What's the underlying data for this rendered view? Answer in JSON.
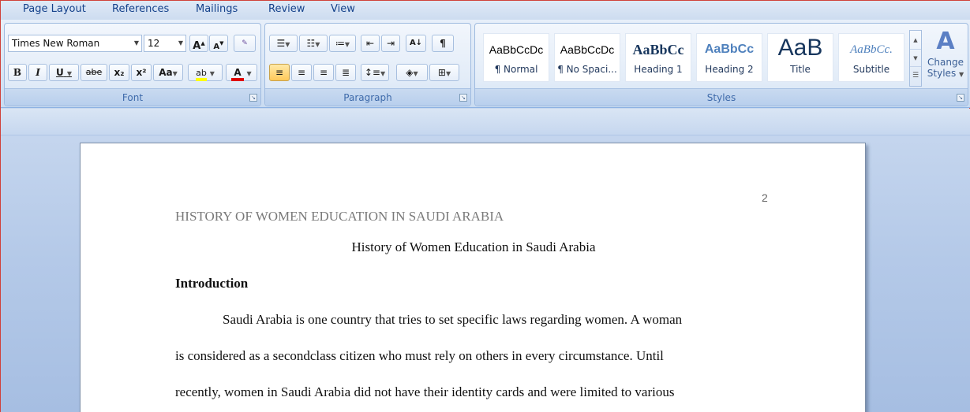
{
  "tabs": [
    "Page Layout",
    "References",
    "Mailings",
    "Review",
    "View"
  ],
  "font": {
    "family": "Times New Roman",
    "size": "12",
    "label": "Font",
    "grow": "A",
    "shrink": "A",
    "bold": "B",
    "italic": "I",
    "underline": "U",
    "strike": "abe",
    "subscript": "x₂",
    "superscript": "x²",
    "change_case": "Aa",
    "highlight": "ab",
    "color": "A"
  },
  "paragraph": {
    "label": "Paragraph",
    "pilcrow": "¶"
  },
  "styles": {
    "label": "Styles",
    "items": [
      {
        "sample": "AaBbCcDc",
        "name": "¶ Normal"
      },
      {
        "sample": "AaBbCcDc",
        "name": "¶ No Spaci..."
      },
      {
        "sample": "AaBbCc",
        "name": "Heading 1"
      },
      {
        "sample": "AaBbCc",
        "name": "Heading 2"
      },
      {
        "sample": "AaB",
        "name": "Title"
      },
      {
        "sample": "AaBbCc.",
        "name": "Subtitle"
      }
    ],
    "change_label_1": "Change",
    "change_label_2": "Styles"
  },
  "colors": {
    "accent": "#15428b",
    "highlight": "#ffff00",
    "font_color": "#e00000"
  },
  "document": {
    "page_number": "2",
    "running_head": "HISTORY OF WOMEN EDUCATION IN SAUDI ARABIA",
    "title": "History of Women Education in Saudi Arabia",
    "heading": "Introduction",
    "lines": [
      "Saudi Arabia is one country that tries to set specific laws regarding women. A woman",
      "is considered as a secondclass citizen who must rely on others in every circumstance. Until",
      "recently, women in Saudi Arabia did not have their identity cards and were limited to various"
    ]
  }
}
